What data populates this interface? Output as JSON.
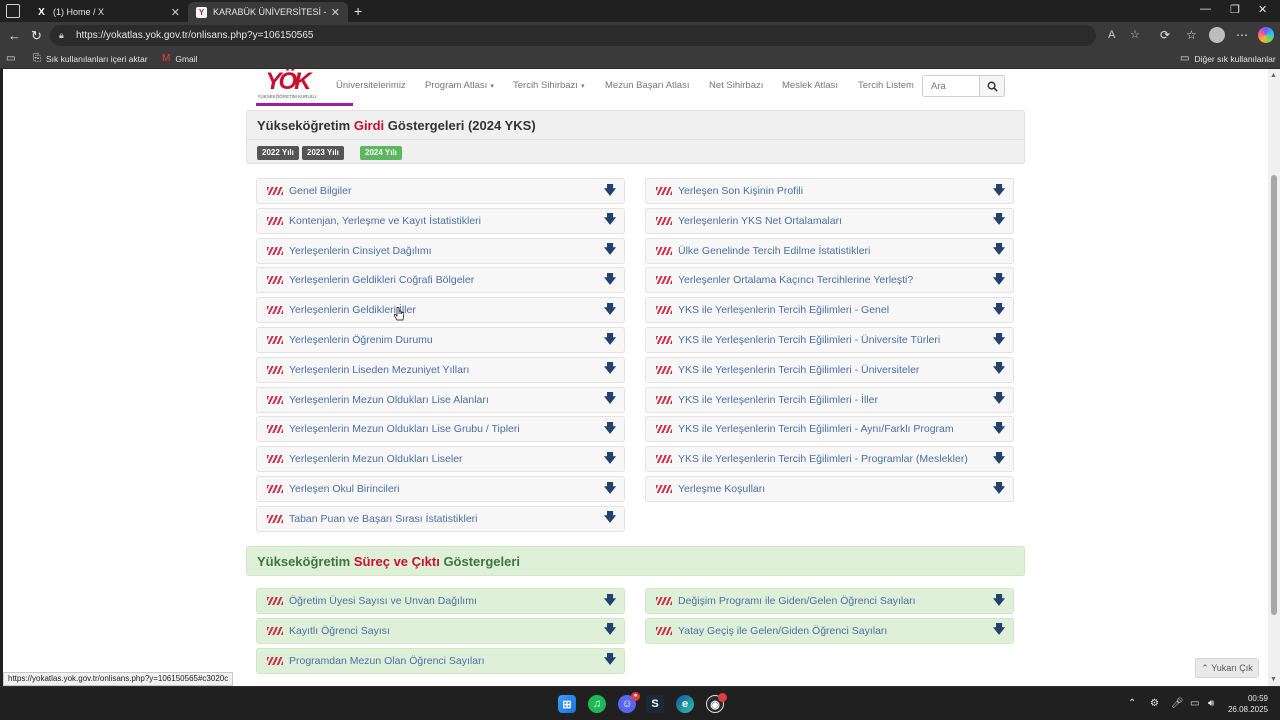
{
  "browser": {
    "tabs": [
      {
        "title": "(1) Home / X"
      },
      {
        "title": "KARABÜK ÜNİVERSİTESİ - Otobo"
      }
    ],
    "url": "https://yokatlas.yok.gov.tr/onlisans.php?y=106150565",
    "bookmarks": {
      "import": "Sık kullanılanları içeri aktar",
      "gmail": "Gmail",
      "other": "Diğer sık kullanılanlar"
    }
  },
  "site": {
    "logo_sub": "YÜKSEKÖĞRETİM KURULU",
    "menu": [
      {
        "label": "Üniversitelerimiz",
        "caret": false
      },
      {
        "label": "Program Atlası",
        "caret": true
      },
      {
        "label": "Tercih Sihirbazı",
        "caret": true
      },
      {
        "label": "Mezun Başarı Atlası",
        "caret": false
      },
      {
        "label": "Net Sihirbazı",
        "caret": false
      },
      {
        "label": "Meslek Atlası",
        "caret": false
      },
      {
        "label": "Tercih Listem",
        "caret": false
      }
    ],
    "search_placeholder": "Ara"
  },
  "girdi": {
    "title_pre": "Yükseköğretim ",
    "title_em": "Girdi",
    "title_post": " Göstergeleri (2024 YKS)",
    "years": [
      "2022 Yılı",
      "2023 Yılı",
      "2024 Yılı"
    ],
    "left": [
      "Genel Bilgiler",
      "Kontenjan, Yerleşme ve Kayıt İstatistikleri",
      "Yerleşenlerin Cinsiyet Dağılımı",
      "Yerleşenlerin Geldikleri Coğrafi Bölgeler",
      "Yerleşenlerin Geldikleri İller",
      "Yerleşenlerin Öğrenim Durumu",
      "Yerleşenlerin Liseden Mezuniyet Yılları",
      "Yerleşenlerin Mezun Oldukları Lise Alanları",
      "Yerleşenlerin Mezun Oldukları Lise Grubu / Tipleri",
      "Yerleşenlerin Mezun Oldukları Liseler",
      "Yerleşen Okul Birincileri",
      "Taban Puan ve Başarı Sırası İstatistikleri"
    ],
    "right": [
      "Yerleşen Son Kişinin Profili",
      "Yerleşenlerin YKS Net Ortalamaları",
      "Ülke Genelinde Tercih Edilme İstatistikleri",
      "Yerleşenler Ortalama Kaçıncı Tercihlerine Yerleşti?",
      "YKS ile Yerleşenlerin Tercih Eğilimleri - Genel",
      "YKS ile Yerleşenlerin Tercih Eğilimleri - Üniversite Türleri",
      "YKS ile Yerleşenlerin Tercih Eğilimleri - Üniversiteler",
      "YKS ile Yerleşenlerin Tercih Eğilimleri - İller",
      "YKS ile Yerleşenlerin Tercih Eğilimleri - Aynı/Farklı Program",
      "YKS ile Yerleşenlerin Tercih Eğilimleri - Programlar (Meslekler)",
      "Yerleşme Koşulları"
    ]
  },
  "surec": {
    "title_pre": "Yükseköğretim ",
    "title_em": "Süreç ve Çıktı",
    "title_post": " Göstergeleri",
    "left": [
      "Öğretim Üyesi Sayısı ve Unvan Dağılımı",
      "Kayıtlı Öğrenci Sayısı",
      "Programdan Mezun Olan Öğrenci Sayıları"
    ],
    "right": [
      "Değişim Programı ile Giden/Gelen Öğrenci Sayıları",
      "Yatay Geçiş ile Gelen/Giden Öğrenci Sayıları"
    ]
  },
  "status_url": "https://yokatlas.yok.gov.tr/onlisans.php?y=106150565#c3020c",
  "scroll_top": "Yukarı Çık",
  "clock": {
    "time": "00:59",
    "date": "26.08.2025"
  },
  "colors": {
    "brand_red": "#c8102e",
    "link_blue": "#4a6fa5",
    "green_panel": "#dff0d8"
  }
}
